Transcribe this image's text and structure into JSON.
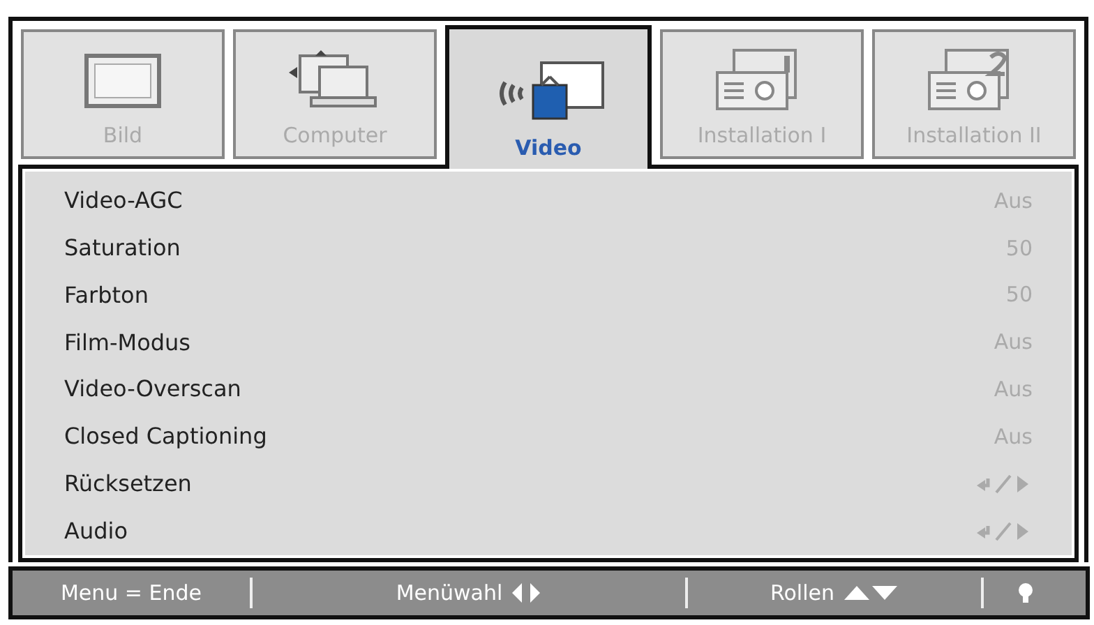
{
  "tabs": [
    {
      "label": "Bild",
      "selected": false
    },
    {
      "label": "Computer",
      "selected": false
    },
    {
      "label": "Video",
      "selected": true
    },
    {
      "label": "Installation I",
      "selected": false
    },
    {
      "label": "Installation II",
      "selected": false
    }
  ],
  "settings": [
    {
      "label": "Video-AGC",
      "kind": "value",
      "value": "Aus"
    },
    {
      "label": "Saturation",
      "kind": "value",
      "value": "50"
    },
    {
      "label": "Farbton",
      "kind": "value",
      "value": "50"
    },
    {
      "label": "Film-Modus",
      "kind": "value",
      "value": "Aus"
    },
    {
      "label": "Video-Overscan",
      "kind": "value",
      "value": "Aus"
    },
    {
      "label": "Closed Captioning",
      "kind": "value",
      "value": "Aus"
    },
    {
      "label": "Rücksetzen",
      "kind": "submenu"
    },
    {
      "label": "Audio",
      "kind": "submenu"
    }
  ],
  "footer": [
    {
      "kind": "text",
      "label": "Menu = Ende"
    },
    {
      "kind": "leftright",
      "label": "Menüwahl"
    },
    {
      "kind": "updown",
      "label": "Rollen"
    },
    {
      "kind": "bulb"
    }
  ]
}
